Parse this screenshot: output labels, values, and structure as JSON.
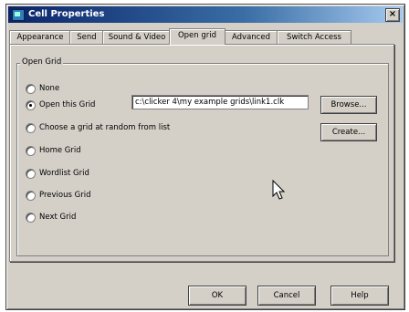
{
  "window": {
    "title": "Cell Properties",
    "close_symbol": "×",
    "app_icon": "cell-app-icon"
  },
  "tabs": [
    {
      "label": "Appearance",
      "active": false
    },
    {
      "label": "Send",
      "active": false
    },
    {
      "label": "Sound & Video",
      "active": false
    },
    {
      "label": "Open grid",
      "active": true
    },
    {
      "label": "Advanced",
      "active": false
    },
    {
      "label": "Switch Access",
      "active": false
    }
  ],
  "group": {
    "label": "Open Grid"
  },
  "options": [
    {
      "label": "None",
      "checked": false
    },
    {
      "label": "Open this Grid",
      "checked": true
    },
    {
      "label": "Choose a grid at random from list",
      "checked": false
    },
    {
      "label": "Home Grid",
      "checked": false
    },
    {
      "label": "Wordlist Grid",
      "checked": false
    },
    {
      "label": "Previous Grid",
      "checked": false
    },
    {
      "label": "Next Grid",
      "checked": false
    }
  ],
  "grid_path": {
    "value": "c:\\clicker 4\\my example grids\\link1.clk"
  },
  "side_buttons": {
    "browse": "Browse...",
    "create": "Create..."
  },
  "footer": {
    "ok": "OK",
    "cancel": "Cancel",
    "help": "Help"
  }
}
